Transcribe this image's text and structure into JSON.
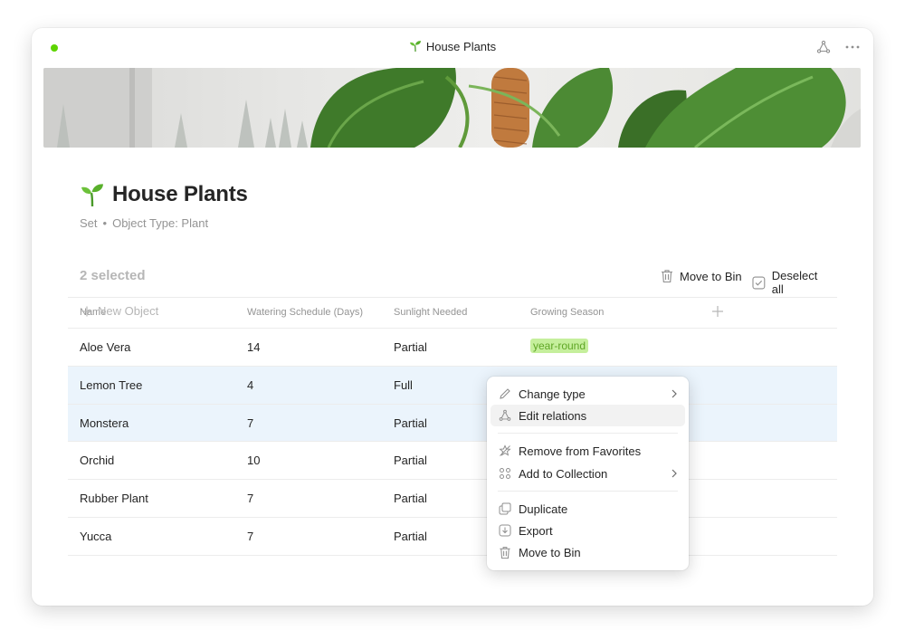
{
  "window": {
    "title": "House Plants",
    "status_color": "#5dd400",
    "icons": [
      "sprout-icon",
      "graph-icon",
      "more-icon"
    ]
  },
  "page": {
    "title": "House Plants",
    "subtitle_layout": "Set",
    "subtitle_separator": "•",
    "subtitle_type": "Object Type: Plant"
  },
  "selection": {
    "count_label": "2 selected",
    "move_to_bin": "Move to Bin",
    "deselect_all": "Deselect all"
  },
  "table": {
    "columns": [
      "Name",
      "Watering Schedule (Days)",
      "Sunlight Needed",
      "Growing Season"
    ],
    "rows": [
      {
        "name": "Aloe Vera",
        "watering": "14",
        "sunlight": "Partial",
        "season": "year-round",
        "selected": false
      },
      {
        "name": "Lemon Tree",
        "watering": "4",
        "sunlight": "Full",
        "season": "",
        "selected": true
      },
      {
        "name": "Monstera",
        "watering": "7",
        "sunlight": "Partial",
        "season": "",
        "selected": true
      },
      {
        "name": "Orchid",
        "watering": "10",
        "sunlight": "Partial",
        "season": "",
        "selected": false
      },
      {
        "name": "Rubber Plant",
        "watering": "7",
        "sunlight": "Partial",
        "season": "",
        "selected": false
      },
      {
        "name": "Yucca",
        "watering": "7",
        "sunlight": "Partial",
        "season": "",
        "selected": false
      }
    ],
    "new_object": "New Object",
    "tag_bg": "#c5ef9c",
    "tag_fg": "#5fa625",
    "selected_row_bg": "#ebf4fc"
  },
  "context_menu": {
    "items": [
      {
        "label": "Change type",
        "icon": "pencil-icon",
        "submenu": true
      },
      {
        "label": "Edit relations",
        "icon": "relations-icon",
        "submenu": false,
        "highlighted": true
      },
      {
        "label": "Remove from Favorites",
        "icon": "star-off-icon",
        "submenu": false
      },
      {
        "label": "Add to Collection",
        "icon": "collection-icon",
        "submenu": true
      },
      {
        "label": "Duplicate",
        "icon": "duplicate-icon",
        "submenu": false
      },
      {
        "label": "Export",
        "icon": "export-icon",
        "submenu": false
      },
      {
        "label": "Move to Bin",
        "icon": "bin-icon",
        "submenu": false
      }
    ]
  }
}
